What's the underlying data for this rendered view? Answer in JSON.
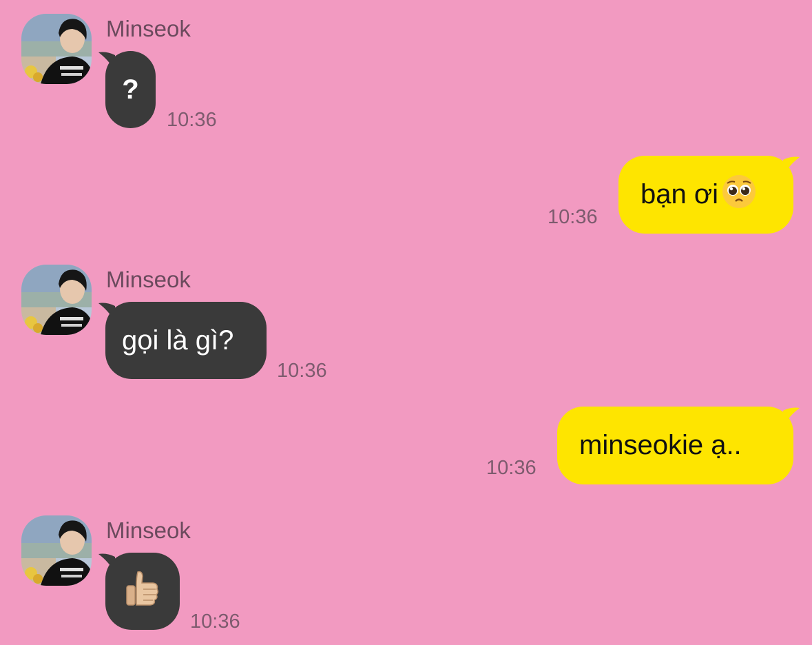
{
  "colors": {
    "background": "#f29ac1",
    "incoming_bubble": "#3a3a3a",
    "outgoing_bubble": "#fee500",
    "sender_name": "#6b4a5d",
    "timestamp": "#7d5b6e"
  },
  "messages": [
    {
      "direction": "incoming",
      "sender": "Minseok",
      "text": "?",
      "time": "10:36"
    },
    {
      "direction": "outgoing",
      "text": "bạn ơi",
      "emoji": "pleading-face",
      "time": "10:36"
    },
    {
      "direction": "incoming",
      "sender": "Minseok",
      "text": "gọi là gì?",
      "time": "10:36"
    },
    {
      "direction": "outgoing",
      "text": "minseokie ạ..",
      "time": "10:36"
    },
    {
      "direction": "incoming",
      "sender": "Minseok",
      "emoji": "thumbs-up",
      "time": "10:36"
    }
  ]
}
